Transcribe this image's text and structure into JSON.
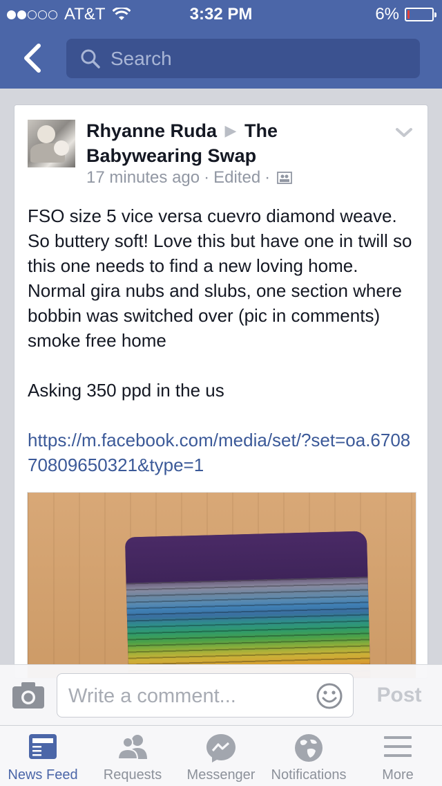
{
  "status_bar": {
    "carrier": "AT&T",
    "signal_bars_filled": 2,
    "signal_bars_total": 5,
    "time": "3:32 PM",
    "battery_percent": "6%",
    "battery_level": 0.06
  },
  "header": {
    "search_placeholder": "Search"
  },
  "post": {
    "author": "Rhyanne Ruda",
    "group": "The Babywearing Swap",
    "time_ago": "17 minutes ago",
    "separator": "·",
    "edited": "Edited",
    "body": "FSO size 5 vice versa cuevro diamond weave. So buttery soft! Love this but have one in twill so this one needs to find a new loving home. Normal gira nubs and slubs, one section where bobbin was switched over (pic in comments) smoke free home",
    "price_line": "Asking 350 ppd in the us",
    "link": "https://m.facebook.com/media/set/?set=oa.670870809650321&type=1"
  },
  "comment_bar": {
    "placeholder": "Write a comment...",
    "post_label": "Post"
  },
  "tabs": [
    {
      "label": "News Feed",
      "icon": "news-feed-icon",
      "active": true
    },
    {
      "label": "Requests",
      "icon": "friend-requests-icon",
      "active": false
    },
    {
      "label": "Messenger",
      "icon": "messenger-icon",
      "active": false
    },
    {
      "label": "Notifications",
      "icon": "globe-icon",
      "active": false
    },
    {
      "label": "More",
      "icon": "hamburger-icon",
      "active": false
    }
  ],
  "colors": {
    "brand_blue": "#4b66a8",
    "link_blue": "#3b5998",
    "muted_text": "#9197a3"
  }
}
